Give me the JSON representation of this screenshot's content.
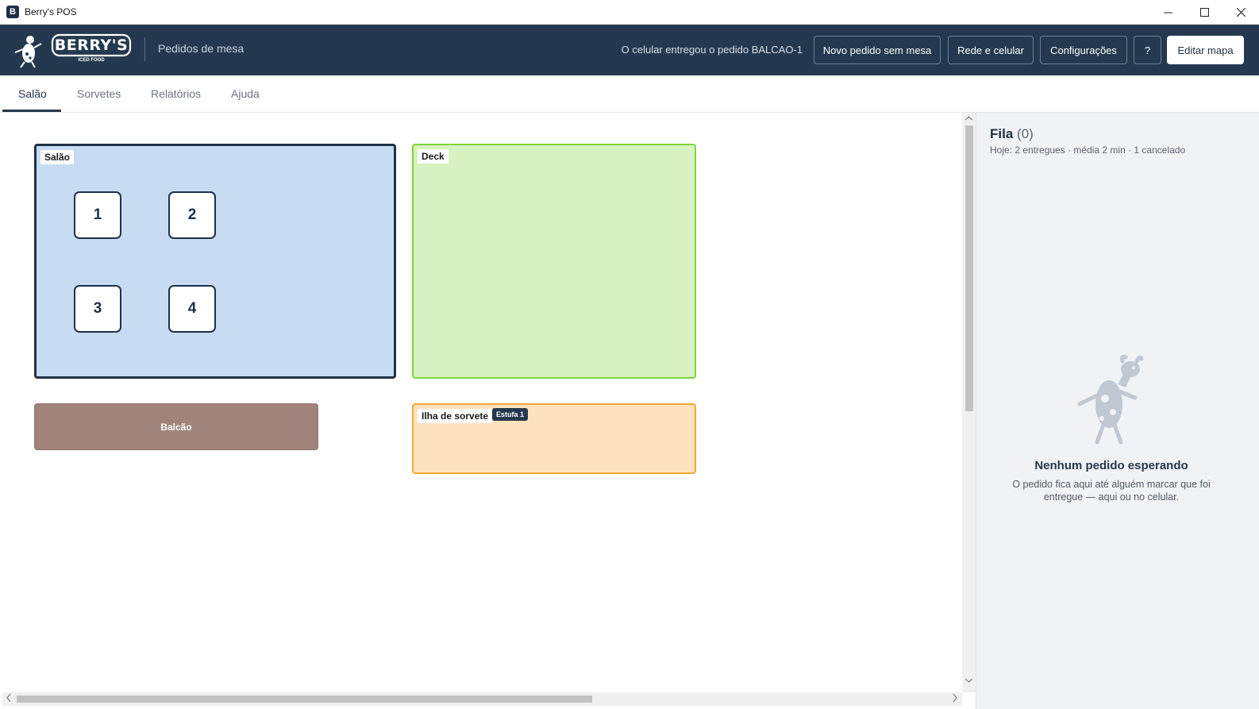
{
  "window": {
    "title": "Berry's POS",
    "controls": {
      "minimize": "—",
      "maximize": "☐",
      "close": "✕"
    }
  },
  "header": {
    "logo_text": "BERRY'S",
    "logo_subtext": "ICED FOOD",
    "subtitle": "Pedidos de mesa",
    "status": "O celular entregou o pedido BALCAO-1",
    "buttons": {
      "new_order": "Novo pedido sem mesa",
      "network": "Rede e celular",
      "settings": "Configurações",
      "help": "?",
      "edit_map": "Editar mapa"
    }
  },
  "tabs": [
    {
      "label": "Salão",
      "active": true
    },
    {
      "label": "Sorvetes",
      "active": false
    },
    {
      "label": "Relatórios",
      "active": false
    },
    {
      "label": "Ajuda",
      "active": false
    }
  ],
  "map": {
    "zones": {
      "salao": {
        "label": "Salão",
        "color": "#c7dbf2",
        "border": "#1f3147"
      },
      "deck": {
        "label": "Deck",
        "color": "#d8f2c2",
        "border": "#7fd43a"
      },
      "balcao": {
        "label": "Balcão",
        "color": "#a0847b"
      },
      "ilha": {
        "label": "Ilha de sorvete",
        "badge": "Estufa 1",
        "color": "#fce3bd",
        "border": "#f0a93a"
      }
    },
    "tables": [
      "1",
      "2",
      "3",
      "4"
    ]
  },
  "queue": {
    "title": "Fila",
    "count": "(0)",
    "stats": "Hoje: 2 entregues · média 2 min · 1 cancelado",
    "empty_title": "Nenhum pedido esperando",
    "empty_desc": "O pedido fica aqui até alguém marcar que foi entregue — aqui ou no celular."
  }
}
